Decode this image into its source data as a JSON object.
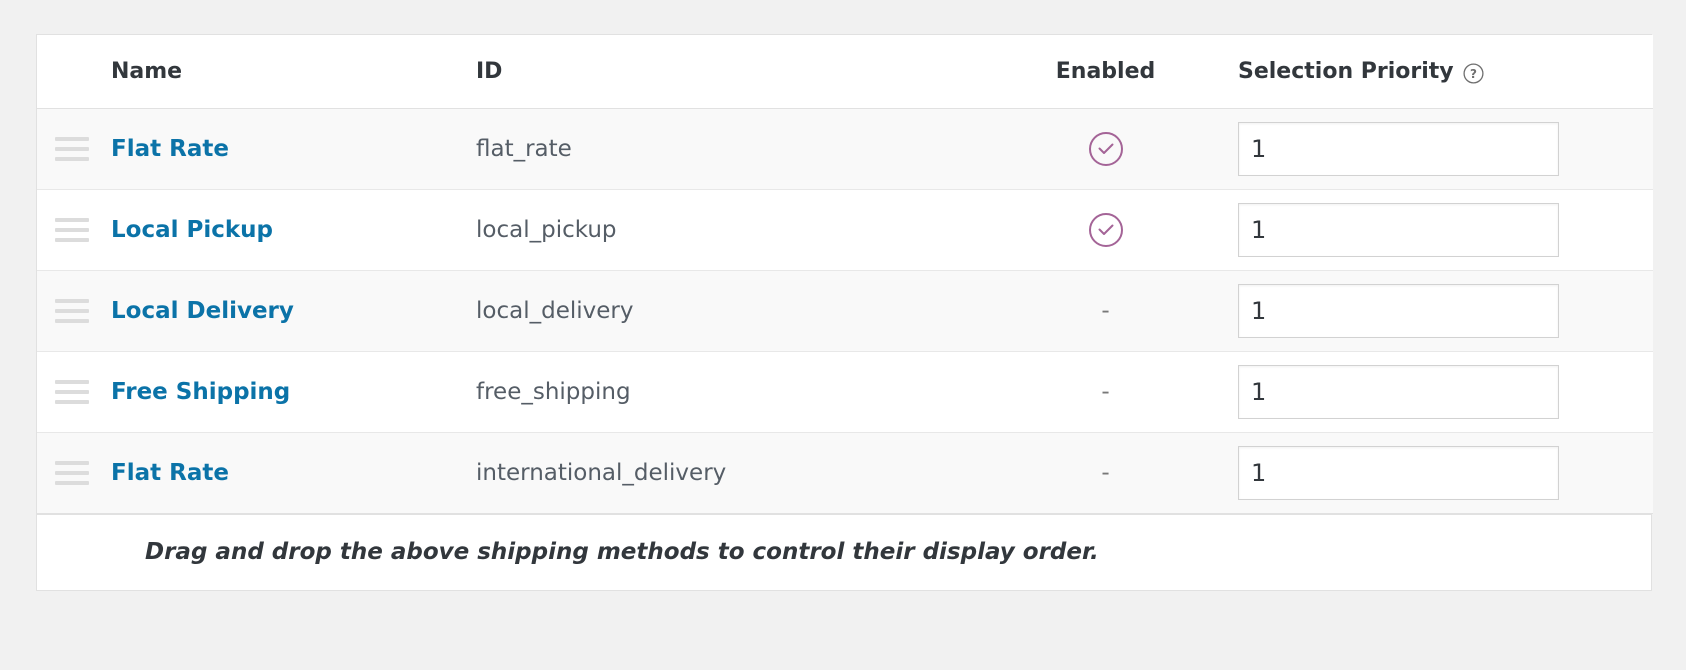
{
  "table": {
    "columns": {
      "handle": "",
      "name": "Name",
      "id": "ID",
      "enabled": "Enabled",
      "priority": "Selection Priority",
      "priority_help_icon": "help-circle-icon"
    },
    "rows": [
      {
        "handle_icon": "drag-handle-icon",
        "name": "Flat Rate",
        "id": "flat_rate",
        "enabled": true,
        "enabled_icon": "check-circle-icon",
        "enabled_dash": "-",
        "priority": "1"
      },
      {
        "handle_icon": "drag-handle-icon",
        "name": "Local Pickup",
        "id": "local_pickup",
        "enabled": true,
        "enabled_icon": "check-circle-icon",
        "enabled_dash": "-",
        "priority": "1"
      },
      {
        "handle_icon": "drag-handle-icon",
        "name": "Local Delivery",
        "id": "local_delivery",
        "enabled": false,
        "enabled_icon": "check-circle-icon",
        "enabled_dash": "-",
        "priority": "1"
      },
      {
        "handle_icon": "drag-handle-icon",
        "name": "Free Shipping",
        "id": "free_shipping",
        "enabled": false,
        "enabled_icon": "check-circle-icon",
        "enabled_dash": "-",
        "priority": "1"
      },
      {
        "handle_icon": "drag-handle-icon",
        "name": "Flat Rate",
        "id": "international_delivery",
        "enabled": false,
        "enabled_icon": "check-circle-icon",
        "enabled_dash": "-",
        "priority": "1"
      }
    ],
    "footer_note": "Drag and drop the above shipping methods to control their display order."
  },
  "colors": {
    "link": "#0b73a8",
    "enabled_check": "#a46497",
    "header_text": "#32373c",
    "id_text": "#555d66",
    "page_bg": "#f1f1f1",
    "row_odd_bg": "#f9f9f9",
    "row_even_bg": "#ffffff",
    "border": "#e1e1e1"
  }
}
